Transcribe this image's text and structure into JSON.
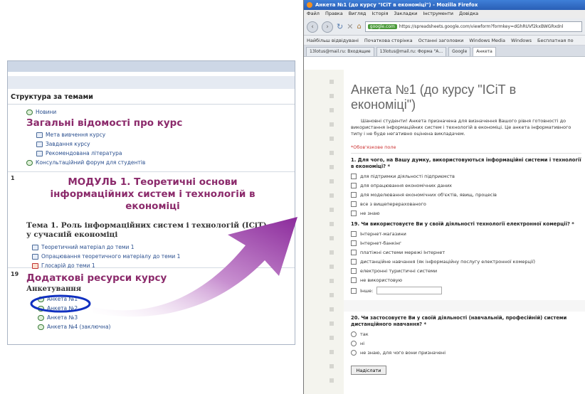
{
  "moodle": {
    "structure_title": "Структура за темами",
    "s0": {
      "news": "Новини",
      "title": "Загальні відомості про курс",
      "items": [
        "Мета вивчення курсу",
        "Завдання курсу",
        "Рекомендована література"
      ],
      "forum": "Консультаційний форум для студентів"
    },
    "s1": {
      "num": "1",
      "title": "МОДУЛЬ 1. Теоретичні основи інформаційних систем і технологій в економіці",
      "topic": "Тема 1. Роль інформаційних систем і технологій (ІСіТ) у сучасній економіці",
      "items": [
        "Теоретичний матеріал до теми 1",
        "Опрацювання теоретичного матеріалу до теми 1",
        "Глосарій до теми 1"
      ]
    },
    "s19": {
      "num": "19",
      "title": "Додаткові ресурси курсу",
      "sub": "Анкетування",
      "items": [
        "Анкета №1",
        "Анкета №2",
        "Анкета №3",
        "Анкета №4 (заключна)"
      ]
    }
  },
  "browser": {
    "title": "Анкета №1 (до курсу \"ІСіТ в економіці\") - Mozilla Firefox",
    "menu": [
      "Файл",
      "Правка",
      "Вигляд",
      "Історія",
      "Закладки",
      "Інструменти",
      "Довідка"
    ],
    "url_domain": "google.com",
    "url": "https://spreadsheets.google.com/viewform?formkey=dGhRUVf2kxBWGRxdnl",
    "bookmarks": [
      "Найбільш відвідувані",
      "Початкова сторінка",
      "Останні заголовки",
      "Windows Media",
      "Windows",
      "Бесплатная по"
    ],
    "tabs": [
      "13lotus@mail.ru: Входящие",
      "13lotus@mail.ru: Форма \"А...",
      "Google",
      "Анкета"
    ]
  },
  "form": {
    "title": "Анкета №1 (до курсу \"ІСіТ в економіці\")",
    "desc": "Шановні студенти! Анкета призначена для визначення Вашого рівня готовності до використання інформаційних систем і технологій в економіці. Це анкета інформативного типу і не буде негативно оцінена викладачем.",
    "required": "*Обов'язкове поле",
    "q1": {
      "text": "1. Для чого, на Вашу думку, використовуються інформаційні системи і технології в економіці? *",
      "options": [
        "для підтримки діяльності підприємств",
        "для опрацювання економічних даних",
        "для моделювання економічних об'єктів, явищ, процесів",
        "все з вищеперерахованого",
        "не знаю"
      ]
    },
    "q19": {
      "text": "19. Чи використовуєте Ви у своїй діяльності технології електронної комерції? *",
      "options": [
        "Інтернет-магазини",
        "Інтернет-банкінг",
        "платіжні системи мережі Інтернет",
        "дистанційне навчання (як інформаційну послугу електронної комерції)",
        "електронні туристичні системи",
        "не використовую"
      ],
      "other": "Інше:"
    },
    "q20": {
      "text": "20. Чи застосовуєте Ви у своїй діяльності (навчальній, професійній) системи дистанційного навчання? *",
      "options": [
        "так",
        "ні",
        "не знаю, для чого вони призначені"
      ]
    },
    "submit": "Надіслати"
  },
  "colors": {
    "arrow": "#8b2a9b",
    "oval": "#1030c0",
    "title_purple": "#8b2a6b"
  }
}
